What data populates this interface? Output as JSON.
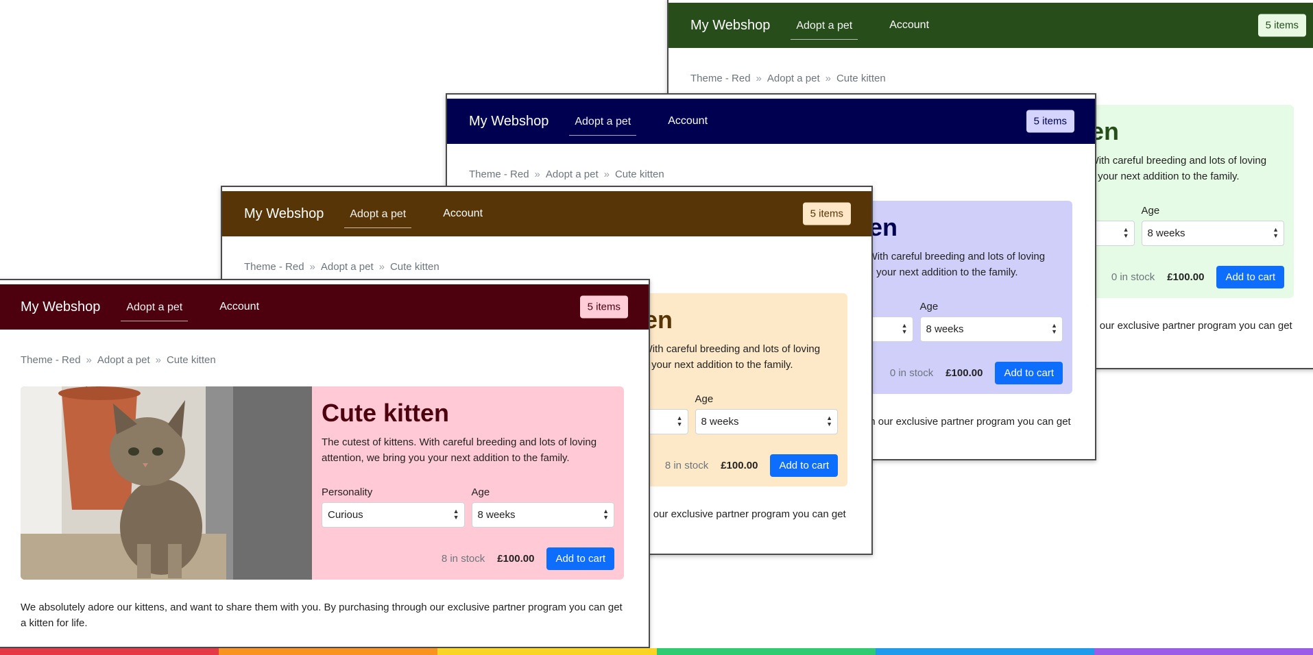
{
  "shop": {
    "brand": "My Webshop",
    "nav_adopt": "Adopt a pet",
    "nav_account": "Account",
    "cart": "5 items",
    "breadcrumb": [
      "Theme - Red",
      "Adopt a pet",
      "Cute kitten"
    ],
    "product": {
      "title": "Cute kitten",
      "description": "The cutest of kittens. With careful breeding and lots of loving attention, we bring you your next addition to the family.",
      "personality_label": "Personality",
      "personality_value": "Curious",
      "age_label": "Age",
      "age_value": "8 weeks",
      "stock": "8 in stock",
      "stock_other": "0 in stock",
      "price": "£100.00",
      "add_to_cart": "Add to cart"
    },
    "footer_text": "We absolutely adore our kittens, and want to share them with you. By purchasing through our exclusive partner program you can get a kitten for life."
  },
  "themes": [
    {
      "name": "green",
      "nav_color": "#264d1a",
      "card_color": "#e6fbe6"
    },
    {
      "name": "navy",
      "nav_color": "#000050",
      "card_color": "#cfcff9"
    },
    {
      "name": "brown",
      "nav_color": "#573506",
      "card_color": "#fde9c8"
    },
    {
      "name": "red",
      "nav_color": "#4d000e",
      "card_color": "#ffcad6"
    }
  ],
  "bottom_stripe_colors": [
    "#e63946",
    "#f7931e",
    "#f9d423",
    "#2ecc71",
    "#1e9be9",
    "#9b5de5"
  ]
}
